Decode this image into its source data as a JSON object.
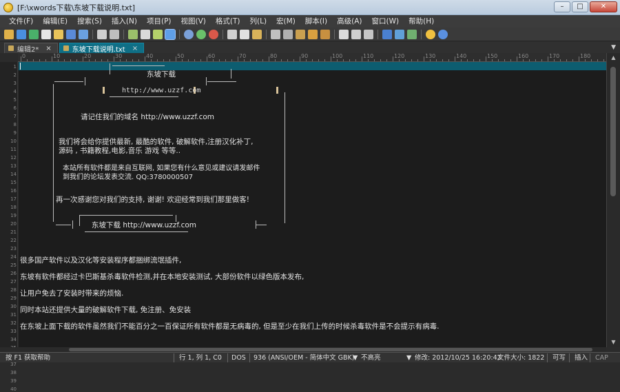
{
  "window": {
    "title": "[F:\\xwords下载\\东坡下载说明.txt]",
    "min": "–",
    "max": "□",
    "close": "✕"
  },
  "menu": [
    "文件(F)",
    "编辑(E)",
    "搜索(S)",
    "插入(N)",
    "项目(P)",
    "视图(V)",
    "格式(T)",
    "列(L)",
    "宏(M)",
    "脚本(I)",
    "高级(A)",
    "窗口(W)",
    "帮助(H)"
  ],
  "tabs": [
    {
      "label": "编辑2*",
      "close": "×",
      "active": false
    },
    {
      "label": "东坡下载说明.txt",
      "close": "×",
      "active": true
    }
  ],
  "ruler": [
    "0",
    "10",
    "20",
    "30",
    "40",
    "50",
    "60",
    "70",
    "80",
    "90",
    "100",
    "110",
    "120",
    "130",
    "140",
    "150",
    "160",
    "170",
    "180",
    "190"
  ],
  "line_numbers": [
    "1",
    "2",
    "3",
    "4",
    "5",
    "6",
    "7",
    "8",
    "9",
    "10",
    "11",
    "12",
    "13",
    "14",
    "15",
    "16",
    "17",
    "18",
    "19",
    "20",
    "21",
    "22",
    "23",
    "24",
    "25",
    "26",
    "27",
    "28",
    "29",
    "30",
    "31",
    "32",
    "33",
    "34",
    "35",
    "36",
    "37",
    "38",
    "39",
    "40"
  ],
  "content": {
    "banner_title": "东坡下载",
    "banner_url": "http://www.uzzf.com",
    "remember": "请记住我们的域名 http://www.uzzf.com",
    "para1_line1": "我们将会给你提供最新, 最酷的软件, 破解软件,注册汉化补丁,",
    "para1_line2": "源码 , 书籍教程,电影,音乐 游戏 等等..",
    "para2_line1": "本站所有软件都是来自互联网, 如果您有什么意见或建议请发邮件",
    "para2_line2": "到我们的论坛发表交流. QQ:3780000507",
    "thanks": "再一次感谢您对我们的支持, 谢谢! 欢迎经常到我们那里做客!",
    "footer_banner": "东坡下载 http://www.uzzf.com",
    "p1": "很多国产软件以及汉化等安装程序都捆绑流氓插件,",
    "p2": "东坡有软件都经过卡巴斯基杀毒软件检测,并在本地安装测试, 大部份软件以绿色版本发布,",
    "p3": "让用户免去了安装时带来的烦恼.",
    "p4": "同时本站还提供大量的破解软件下载, 免注册、免安装",
    "p5": "在东坡上面下载的软件虽然我们不能百分之一百保证所有软件都是无病毒的, 但是至少在我们上传的时候杀毒软件是不会提示有病毒."
  },
  "status": {
    "help": "按 F1 获取帮助",
    "position": "行 1, 列 1, C0",
    "format": "DOS",
    "encoding": "936 (ANSI/OEM - 简体中文 GBK)",
    "highlight": "不高亮",
    "modified": "修改: 2012/10/25 16:20:42",
    "filesize": "文件大小: 1822",
    "mode": "可写",
    "insert": "插入",
    "caps": "CAP"
  },
  "colors": {
    "accent": "#0f6f86",
    "editor_bg": "#1c1c1c",
    "current_line": "#0d5d70"
  }
}
